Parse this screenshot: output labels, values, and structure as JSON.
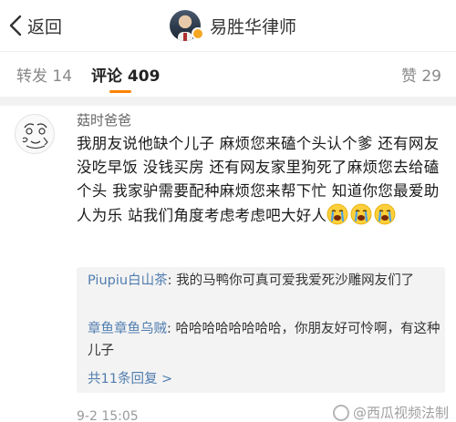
{
  "navbar": {
    "back_label": "返回",
    "title": "易胜华律师",
    "avatar_icon": "lawyer-avatar",
    "verified_badge_color": "#f5a623"
  },
  "tabs": {
    "repost": "转发 14",
    "comment": "评论 409",
    "like": "赞 29",
    "active_color": "#ff8200"
  },
  "comment": {
    "username": "菇时爸爸",
    "text": "我朋友说他缺个儿子 麻烦您来磕个头认个爹 还有网友没吃早饭 没钱买房 还有网友家里狗死了麻烦您去给磕个头 我家驴需要配种麻烦您来帮下忙 知道你您最爱助人为乐 站我们角度考虑考虑吧大好人",
    "emojis": [
      "crying-face",
      "crying-face",
      "crying-face"
    ],
    "timestamp": "9-2 15:05"
  },
  "replies": [
    {
      "name": "Piupiu白山茶",
      "text": "我的马鸭你可真可爱我爱死沙雕网友们了"
    },
    {
      "name": "章鱼章鱼乌贼",
      "text": "哈哈哈哈哈哈哈哈，你朋友好可怜啊，有这种儿子"
    }
  ],
  "more_replies": "共11条回复 >",
  "watermark": "@西瓜视频法制"
}
